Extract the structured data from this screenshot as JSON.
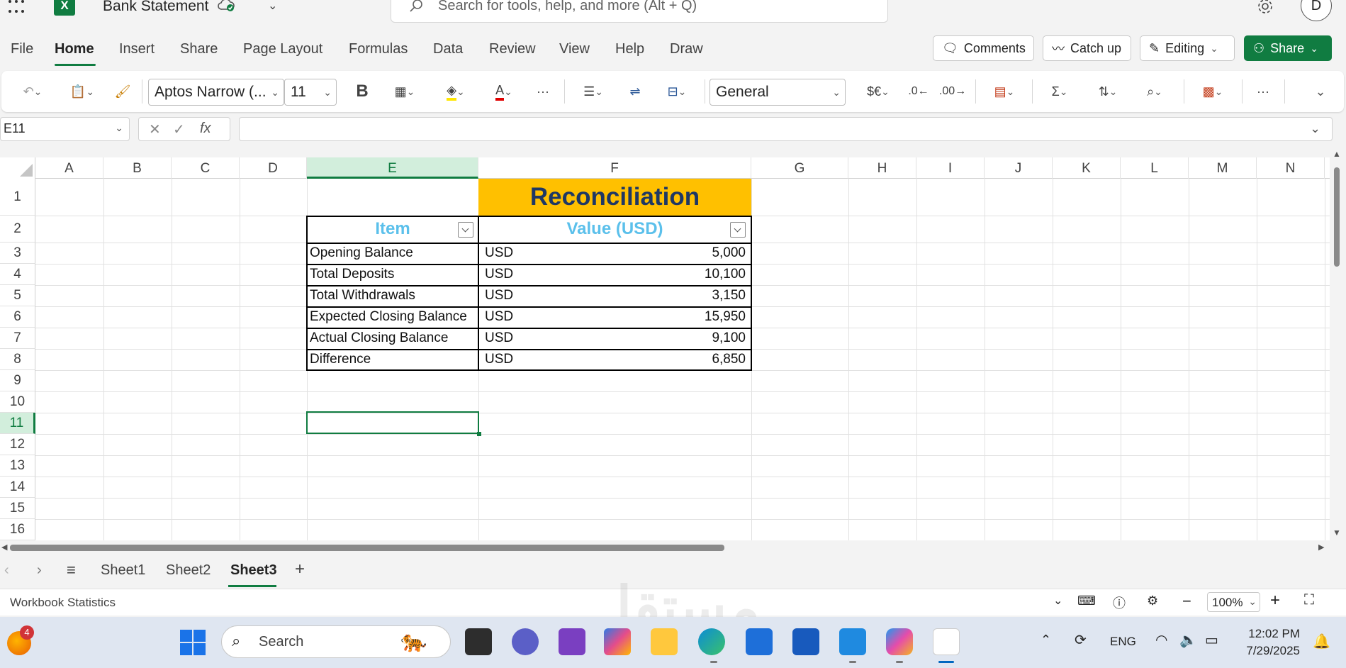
{
  "titlebar": {
    "app_logo": "X",
    "doc_title": "Bank Statement",
    "search_placeholder": "Search for tools, help, and more (Alt + Q)",
    "avatar_initial": "D"
  },
  "menu": {
    "tabs": [
      "File",
      "Home",
      "Insert",
      "Share",
      "Page Layout",
      "Formulas",
      "Data",
      "Review",
      "View",
      "Help",
      "Draw"
    ],
    "active": "Home",
    "comments_label": "Comments",
    "catchup_label": "Catch up",
    "editing_label": "Editing",
    "share_label": "Share"
  },
  "ribbon": {
    "font_name": "Aptos Narrow (...",
    "font_size": "11",
    "number_format": "General",
    "bold_label": "B",
    "currency_label": "$€"
  },
  "formula_bar": {
    "name_box": "E11",
    "fx_label": "fx",
    "formula": ""
  },
  "grid": {
    "columns": [
      "A",
      "B",
      "C",
      "D",
      "E",
      "F",
      "G",
      "H",
      "I",
      "J",
      "K",
      "L",
      "M",
      "N"
    ],
    "rows": [
      "1",
      "2",
      "3",
      "4",
      "5",
      "6",
      "7",
      "8",
      "9",
      "10",
      "11",
      "12",
      "13",
      "14",
      "15",
      "16"
    ],
    "selected_column": "E",
    "selected_row": "11"
  },
  "table": {
    "title": "Reconciliation",
    "headers": [
      "Item",
      "Value (USD)"
    ],
    "rows": [
      {
        "item": "Opening Balance",
        "currency": "USD",
        "value": "5,000"
      },
      {
        "item": "Total Deposits",
        "currency": "USD",
        "value": "10,100"
      },
      {
        "item": "Total Withdrawals",
        "currency": "USD",
        "value": "3,150"
      },
      {
        "item": "Expected Closing Balance",
        "currency": "USD",
        "value": "15,950"
      },
      {
        "item": "Actual Closing Balance",
        "currency": "USD",
        "value": "9,100"
      },
      {
        "item": "Difference",
        "currency": "USD",
        "value": "6,850"
      }
    ]
  },
  "sheets": {
    "tabs": [
      "Sheet1",
      "Sheet2",
      "Sheet3"
    ],
    "active": "Sheet3"
  },
  "status": {
    "text": "Workbook Statistics",
    "zoom": "100%"
  },
  "taskbar": {
    "badge": "4",
    "search_label": "Search",
    "lang": "ENG",
    "time": "12:02 PM",
    "date": "7/29/2025"
  },
  "colors": {
    "accent": "#107c41",
    "title_fill": "#ffc000",
    "title_text": "#1f3864",
    "header_text": "#5bc0eb"
  }
}
